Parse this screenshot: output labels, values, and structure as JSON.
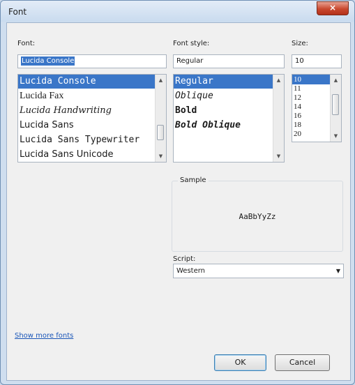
{
  "window": {
    "title": "Font",
    "close_glyph": "×"
  },
  "font": {
    "label": "Font:",
    "value": "Lucida Console",
    "options": [
      "Lucida Console",
      "Lucida Fax",
      "Lucida Handwriting",
      "Lucida Sans",
      "Lucida Sans Typewriter",
      "Lucida Sans Unicode"
    ],
    "selected_index": 0
  },
  "font_style": {
    "label": "Font style:",
    "value": "Regular",
    "options": [
      "Regular",
      "Oblique",
      "Bold",
      "Bold Oblique"
    ],
    "selected_index": 0
  },
  "size": {
    "label": "Size:",
    "value": "10",
    "options": [
      "10",
      "11",
      "12",
      "14",
      "16",
      "18",
      "20"
    ],
    "selected_index": 0
  },
  "sample": {
    "label": "Sample",
    "text": "AaBbYyZz"
  },
  "script": {
    "label": "Script:",
    "value": "Western"
  },
  "links": {
    "show_more_fonts": "Show more fonts"
  },
  "buttons": {
    "ok": "OK",
    "cancel": "Cancel"
  },
  "colors": {
    "selection": "#3a76c8",
    "link": "#1a56b8",
    "close": "#c9492f"
  }
}
